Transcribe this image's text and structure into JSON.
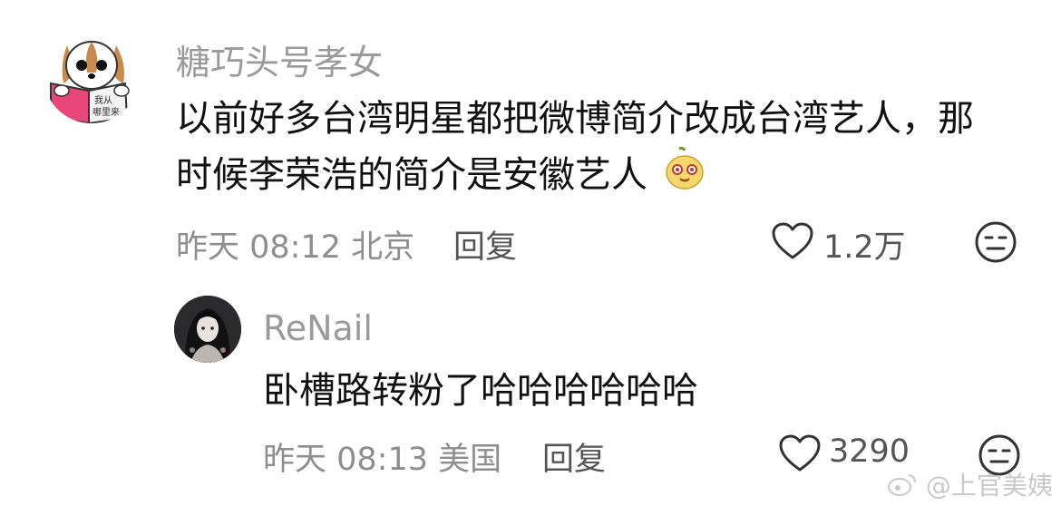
{
  "comment": {
    "username": "糖巧头号孝女",
    "avatar_book_text": "我从哪里来",
    "text_line1": "以前好多台湾明星都把微博简介改成台湾艺人，那",
    "text_line2": "时候李荣浩的简介是安徽艺人",
    "emoji": "smiling-pear-emoji",
    "time": "昨天 08:12",
    "location": "北京",
    "reply_label": "回复",
    "like_count": "1.2万",
    "like_icon": "heart-icon",
    "dislike_icon": "meh-face-icon"
  },
  "reply": {
    "username": "ReNail",
    "text": "卧槽路转粉了哈哈哈哈哈哈",
    "time": "昨天 08:13",
    "location": "美国",
    "reply_label": "回复",
    "like_count": "3290",
    "like_icon": "heart-icon",
    "dislike_icon": "meh-face-icon"
  },
  "watermark": {
    "text": "@上官美姨",
    "icon": "weibo-logo-icon"
  },
  "colors": {
    "username": "#9a9a9a",
    "body": "#111111",
    "meta": "#8e8e8e",
    "book": "#e8457a",
    "dog_brown": "#c98a4b"
  }
}
